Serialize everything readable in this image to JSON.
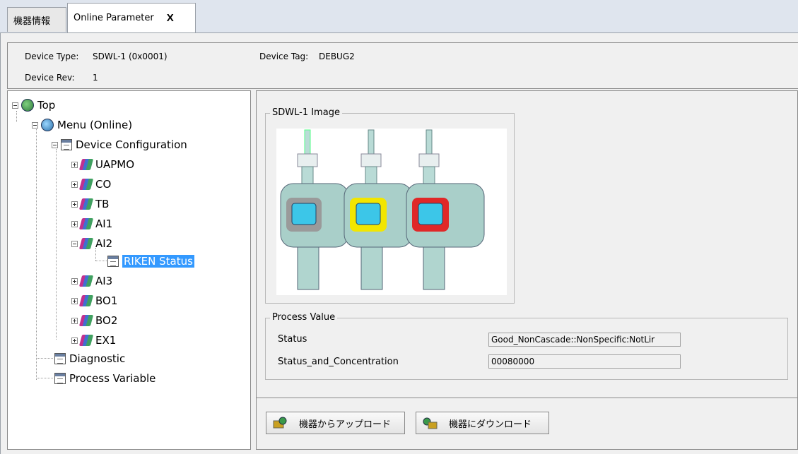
{
  "tabs": [
    {
      "label": "機器情報",
      "active": false
    },
    {
      "label": "Online Parameter",
      "active": true,
      "close": "X"
    }
  ],
  "device_info": {
    "type_label": "Device Type:",
    "type_value": "SDWL-1 (0x0001)",
    "rev_label": "Device Rev:",
    "rev_value": "1",
    "tag_label": "Device Tag:",
    "tag_value": "DEBUG2"
  },
  "tree": {
    "top": "Top",
    "menu": "Menu (Online)",
    "device_configuration": "Device Configuration",
    "blocks": [
      "UAPMO",
      "CO",
      "TB",
      "AI1",
      "AI2",
      "AI3",
      "BO1",
      "BO2",
      "EX1"
    ],
    "ai2_child": "RIKEN Status",
    "diagnostic": "Diagnostic",
    "process_variable": "Process Variable"
  },
  "image_group": {
    "legend": "SDWL-1 Image",
    "bezel_colors": [
      "#9a9a9a",
      "#f2e600",
      "#e02828"
    ]
  },
  "process_value": {
    "legend": "Process Value",
    "rows": [
      {
        "label": "Status",
        "value": "Good_NonCascade::NonSpecific:NotLir"
      },
      {
        "label": "Status_and_Concentration",
        "value": "00080000"
      }
    ]
  },
  "buttons": {
    "upload": "機器からアップロード",
    "download": "機器にダウンロード"
  }
}
